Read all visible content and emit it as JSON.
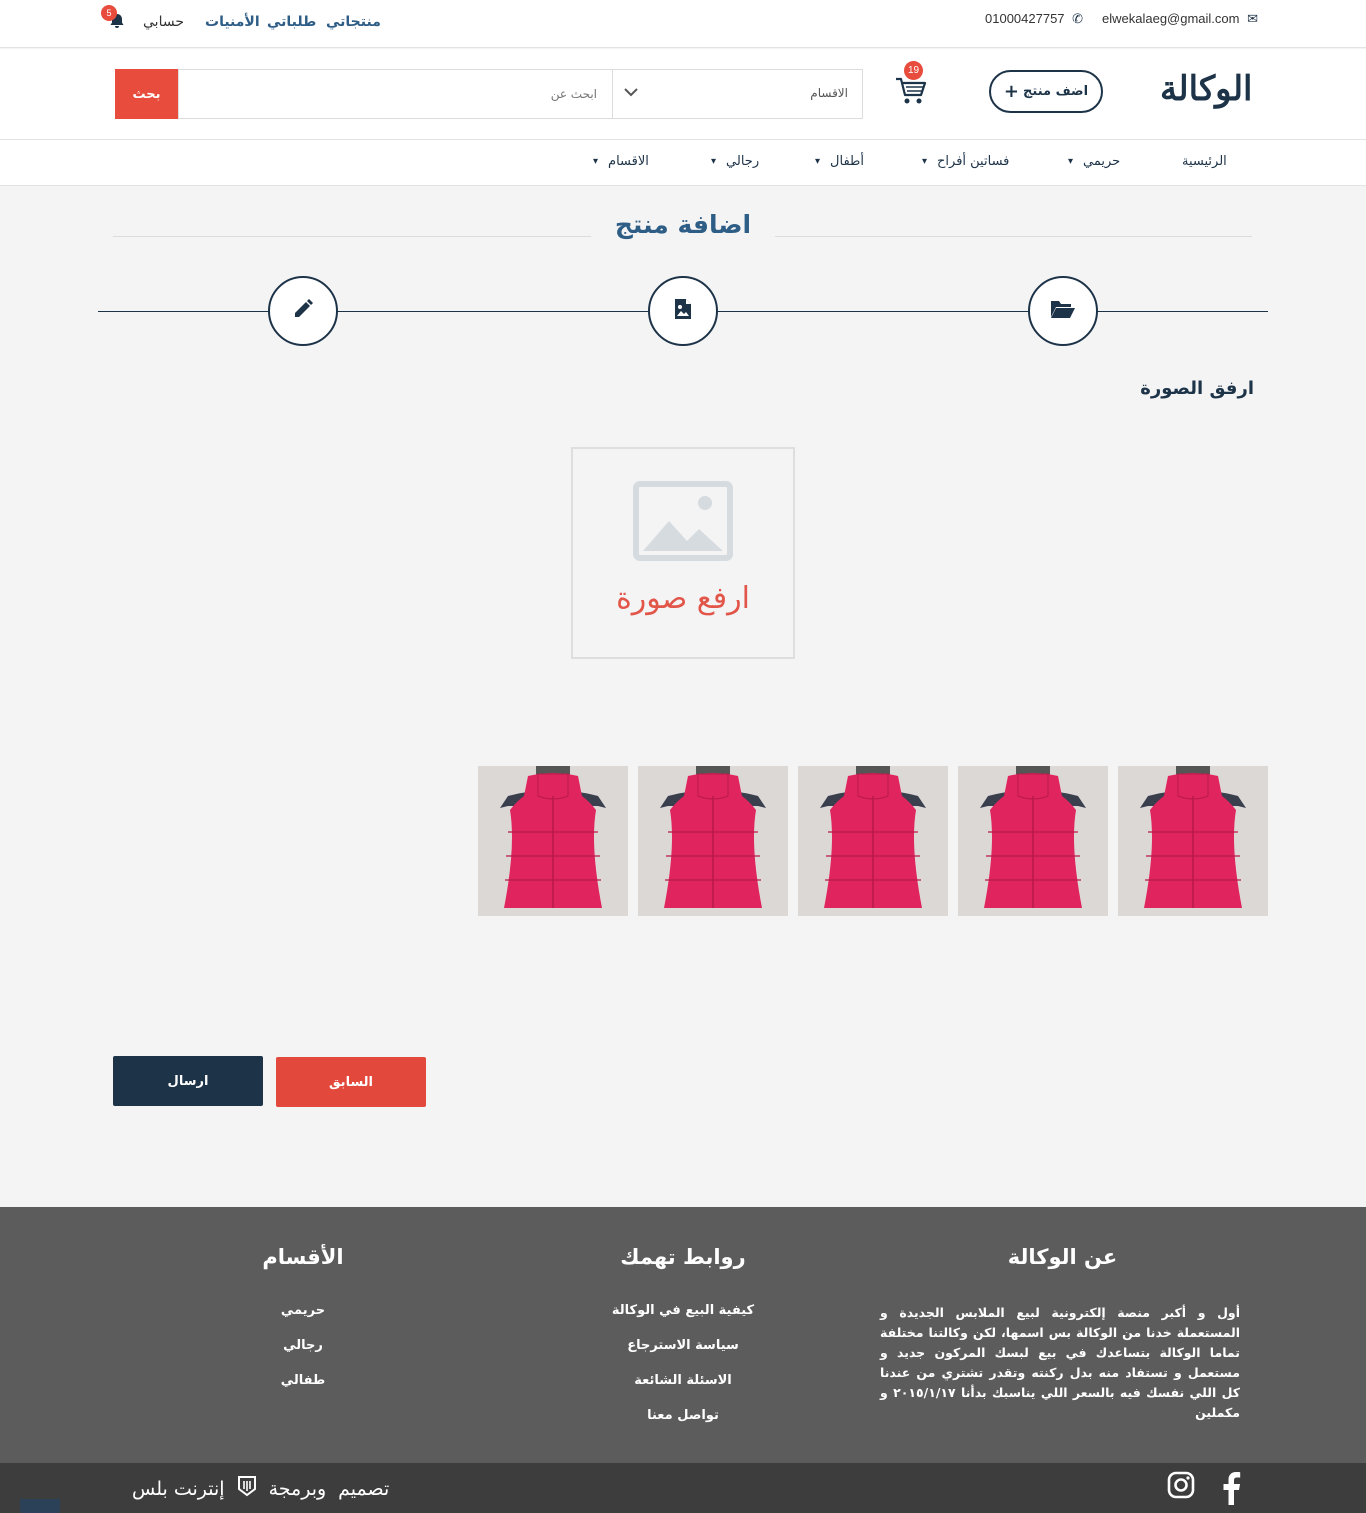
{
  "topbar": {
    "email": "elwekalaeg@gmail.com",
    "phone": "01000427757",
    "links": [
      "منتجاتي",
      "طلباتي",
      "الأمنيات",
      "حسابي"
    ],
    "notification_count": "5"
  },
  "header": {
    "logo": "الوكالة",
    "add_product_label": "اضف منتج",
    "cart_count": "19",
    "categories_label": "الاقسام",
    "search_placeholder": "ابحث عن",
    "search_button": "بحث"
  },
  "nav": {
    "items": [
      {
        "label": "الرئيسية"
      },
      {
        "label": "حريمي"
      },
      {
        "label": "فساتين أفراح"
      },
      {
        "label": "أطفال"
      },
      {
        "label": "رجالي"
      },
      {
        "label": "الاقسام"
      }
    ]
  },
  "main": {
    "title": "اضافة منتج",
    "steps": [
      "folder-open-icon",
      "file-image-icon",
      "pencil-icon"
    ],
    "attach_label": "ارفق الصورة",
    "upload_text": "ارفع صورة",
    "thumbnail_count": 5,
    "thumbnail_color": "#e0245e",
    "prev_button": "السابق",
    "send_button": "ارسال"
  },
  "footer": {
    "about": {
      "title": "عن الوكالة",
      "text": "أول و أكبر منصة إلكترونية لبيع الملابس الجديدة و المستعملة خدنا من الوكالة بس اسمها، لكن وكالتنا مختلفة تماما الوكالة بتساعدك في بيع لبسك المركون جديد و مستعمل و تستفاد منه بدل ركنته وتقدر تشتري من عندنا كل اللي نفسك فيه بالسعر اللي يناسبك بدأنا ٢٠١٥/١/١٧ و مكملين"
    },
    "links": {
      "title": "روابط تهمك",
      "items": [
        "كيفية البيع في الوكالة",
        "سياسة الاسترجاع",
        "الاسئلة الشائعة",
        "تواصل معنا"
      ]
    },
    "categories": {
      "title": "الأقسام",
      "items": [
        "حريمي",
        "رجالي",
        "طفالي"
      ]
    },
    "credits": {
      "design": "تصميم",
      "programming": "وبرمجة",
      "company": "إنترنت بلس"
    }
  },
  "colors": {
    "primary": "#1d3348",
    "accent": "#e74c3c",
    "title": "#2e5d86",
    "footer": "#5c5c5c",
    "bottombar": "#3d3d3d"
  }
}
